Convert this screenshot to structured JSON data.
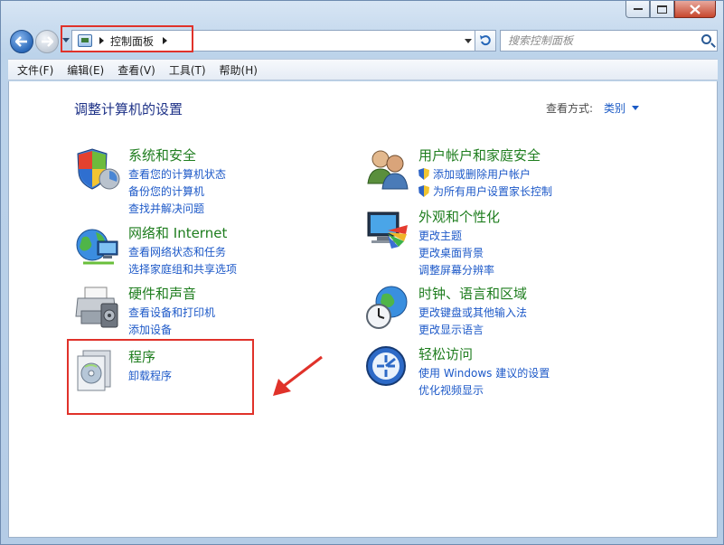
{
  "window": {
    "caption_buttons": [
      {
        "name": "minimize",
        "glyph": "–"
      },
      {
        "name": "maximize",
        "glyph": "□"
      },
      {
        "name": "close",
        "glyph": "✕"
      }
    ]
  },
  "address_bar": {
    "breadcrumb": "控制面板",
    "search_placeholder": "搜索控制面板"
  },
  "menu": {
    "items": [
      "文件(F)",
      "编辑(E)",
      "查看(V)",
      "工具(T)",
      "帮助(H)"
    ]
  },
  "content": {
    "title": "调整计算机的设置",
    "view_by_label": "查看方式:",
    "view_by_value": "类别"
  },
  "categories": [
    {
      "key": "security",
      "title": "系统和安全",
      "icon": "shield-icon",
      "links": [
        "查看您的计算机状态",
        "备份您的计算机",
        "查找并解决问题"
      ]
    },
    {
      "key": "network",
      "title": "网络和 Internet",
      "icon": "globe-network-icon",
      "links": [
        "查看网络状态和任务",
        "选择家庭组和共享选项"
      ]
    },
    {
      "key": "hardware",
      "title": "硬件和声音",
      "icon": "printer-icon",
      "links": [
        "查看设备和打印机",
        "添加设备"
      ]
    },
    {
      "key": "programs",
      "title": "程序",
      "icon": "programs-icon",
      "links": [
        "卸载程序"
      ]
    },
    {
      "key": "users",
      "title": "用户帐户和家庭安全",
      "icon": "users-icon",
      "links": [
        "添加或删除用户帐户",
        "为所有用户设置家长控制"
      ]
    },
    {
      "key": "appearance",
      "title": "外观和个性化",
      "icon": "monitor-palette-icon",
      "links": [
        "更改主题",
        "更改桌面背景",
        "调整屏幕分辨率"
      ]
    },
    {
      "key": "clock",
      "title": "时钟、语言和区域",
      "icon": "clock-globe-icon",
      "links": [
        "更改键盘或其他输入法",
        "更改显示语言"
      ]
    },
    {
      "key": "access",
      "title": "轻松访问",
      "icon": "ease-of-access-icon",
      "links": [
        "使用 Windows 建议的设置",
        "优化视频显示"
      ]
    }
  ],
  "colors": {
    "category_title": "#1e7d1e",
    "link": "#1d59c8",
    "page_title": "#1e3287",
    "highlight": "#e0322a"
  }
}
